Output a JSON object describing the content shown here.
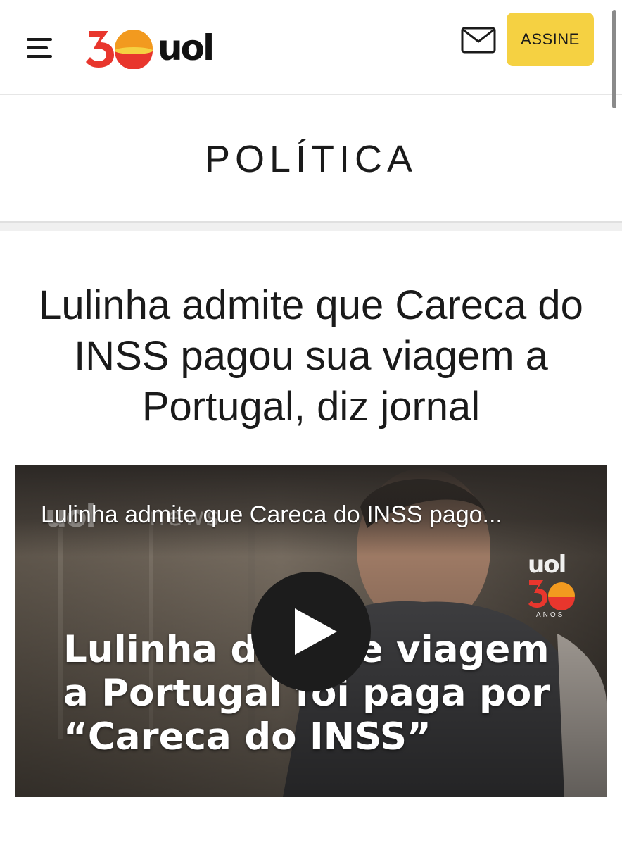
{
  "header": {
    "menu_icon": "hamburger-menu-icon",
    "logo": {
      "anniversary": "30",
      "brand": "uol",
      "colors": {
        "red": "#e8362d",
        "orange": "#f29a1f",
        "yellow": "#f5d142"
      }
    },
    "mail_icon": "envelope-icon",
    "subscribe_label": "ASSINE",
    "subscribe_color": "#f5d142"
  },
  "section": {
    "title": "POLÍTICA"
  },
  "article": {
    "headline": "Lulinha admite que Careca do INSS pagou sua viagem a Portugal, diz jornal"
  },
  "video": {
    "title": "Lulinha admite que Careca do INSS pago...",
    "watermark_brand": "uol",
    "watermark_news": "news",
    "badge_brand": "uol",
    "badge_number": "30",
    "badge_sub": "ANOS",
    "caption": "Lulinha diz que viagem a Portugal foi paga por “Careca do INSS”",
    "play_icon": "play-icon"
  }
}
